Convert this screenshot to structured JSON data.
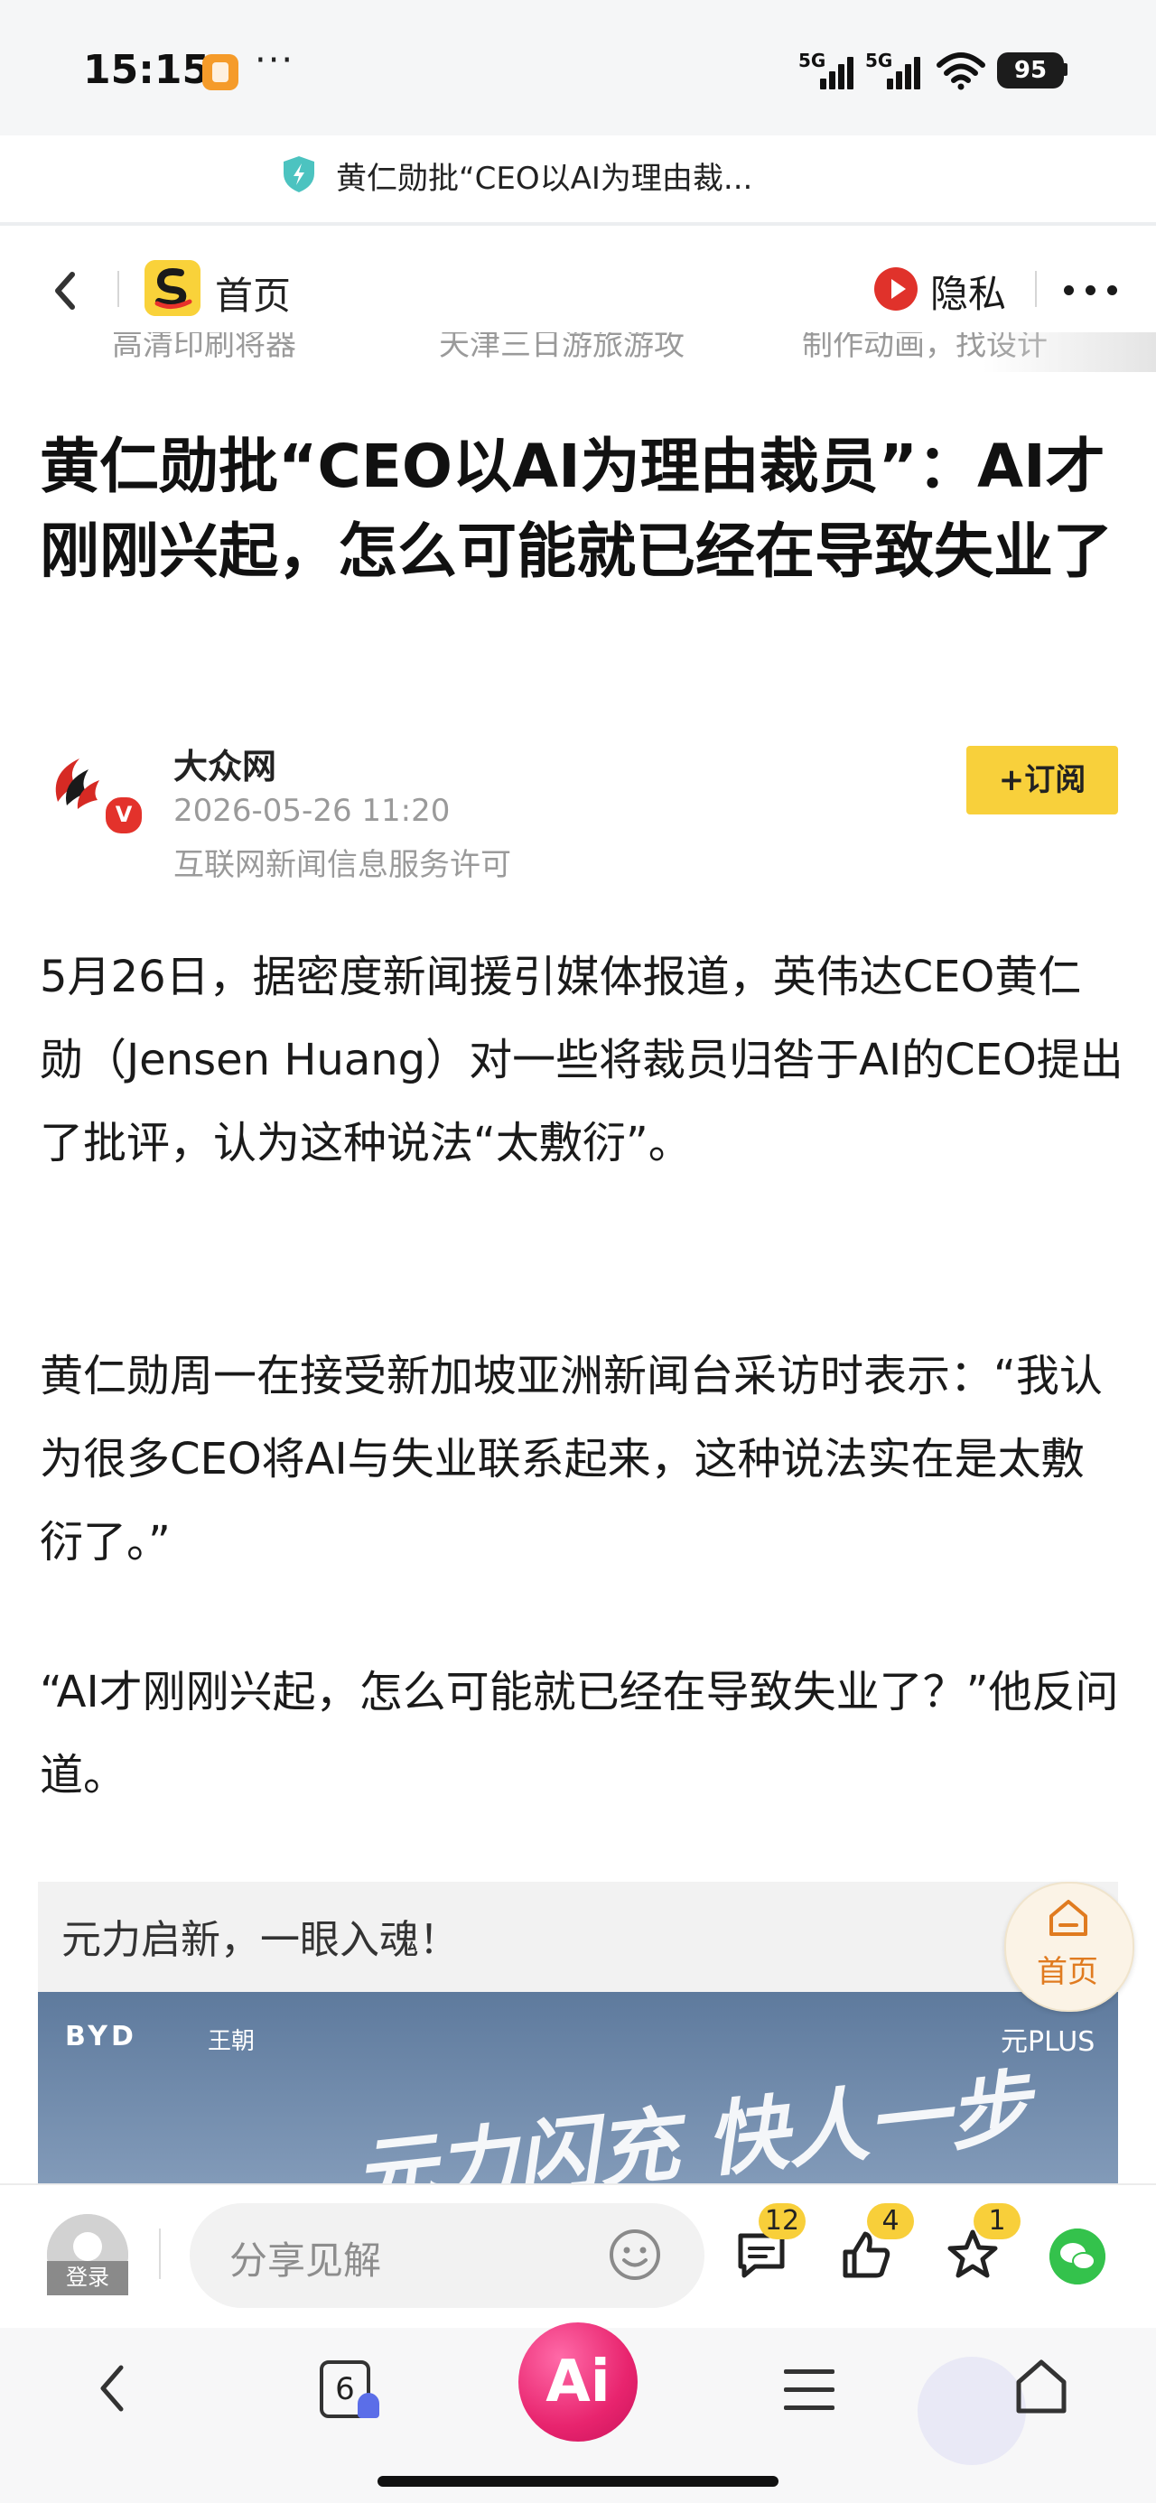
{
  "status_bar": {
    "time": "15:15",
    "dots": "···",
    "signal_1": "5G",
    "signal_2": "5G",
    "battery": "95"
  },
  "url_bar": {
    "title": "黄仁勋批“CEO以AI为理由裁..."
  },
  "header": {
    "home_label": "首页",
    "privacy_label": "隐私"
  },
  "ticker": {
    "items": [
      "高清印刷将器",
      "天津三日游旅游攻",
      "制作动画，找设计"
    ]
  },
  "article": {
    "title": "黄仁勋批“CEO以AI为理由裁员”：AI才刚刚兴起，怎么可能就已经在导致失业了",
    "author": {
      "name": "大众网",
      "verified_badge": "V",
      "date": "2026-05-26 11:20",
      "license": "互联网新闻信息服务许可"
    },
    "subscribe_label": "+订阅",
    "paragraphs": [
      "5月26日，据密度新闻援引媒体报道，英伟达CEO黄仁勋（Jensen Huang）对一些将裁员归咎于AI的CEO提出了批评，认为这种说法“太敷衍”。",
      "黄仁勋周一在接受新加坡亚洲新闻台采访时表示：“我认为很多CEO将AI与失业联系起来，这种说法实在是太敷衍了。”",
      "“AI才刚刚兴起，怎么可能就已经在导致失业了？”他反问道。"
    ]
  },
  "ad": {
    "caption": "元力启新，一眼入魂！",
    "brand": "BYD",
    "sub_brand": "王朝",
    "model": "元PLUS",
    "slogan": "元力闪充 快人一步"
  },
  "float_home": {
    "label": "首页"
  },
  "comment_bar": {
    "login_label": "登录",
    "input_placeholder": "分享见解",
    "comments_count": "12",
    "likes_count": "4",
    "favorites_count": "1"
  },
  "browser_bar": {
    "tabs_count": "6",
    "ai_label": "Ai"
  },
  "colors": {
    "accent_yellow": "#f8d03b",
    "privacy_red": "#e0322b",
    "ai_pink": "#e8246e",
    "wechat_green": "#34c24c"
  }
}
